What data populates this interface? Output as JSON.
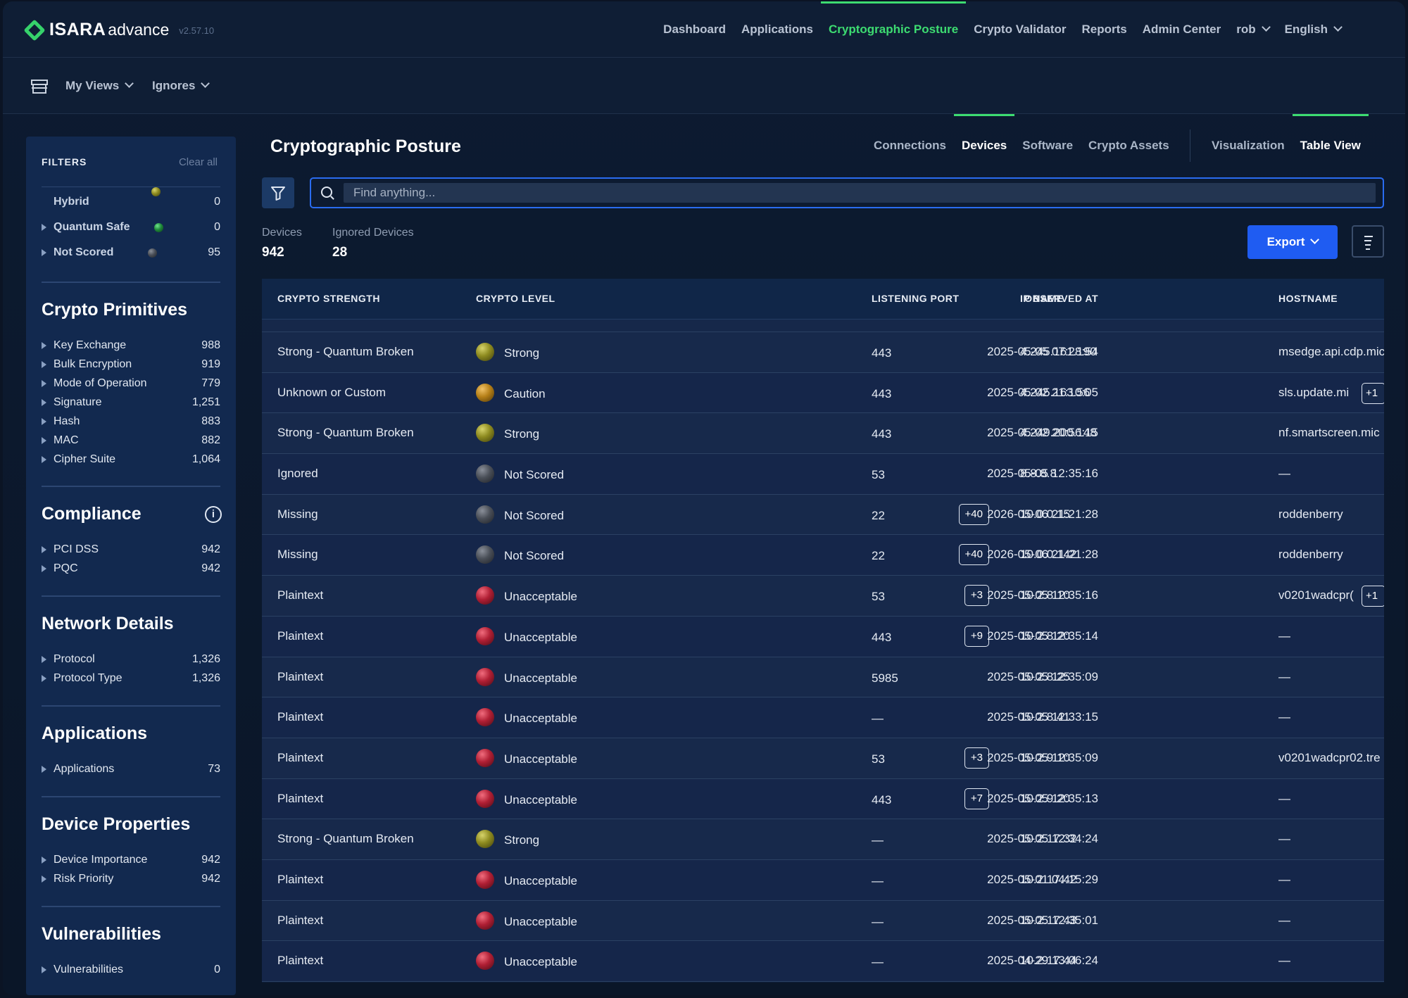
{
  "app": {
    "brand": "ISARA",
    "brand_sub": "advance",
    "version": "v2.57.10",
    "colors": {
      "accent": "#3ddc71",
      "primary": "#1f5cf2",
      "panel": "#12294f"
    }
  },
  "topnav": {
    "items": [
      "Dashboard",
      "Applications",
      "Cryptographic Posture",
      "Crypto Validator",
      "Reports",
      "Admin Center"
    ],
    "active": "Cryptographic Posture",
    "user": "rob",
    "language": "English"
  },
  "subbar": {
    "icon": "store-icon",
    "my_views": "My Views",
    "ignores": "Ignores"
  },
  "filters": {
    "title": "FILTERS",
    "clear_all": "Clear all",
    "score_rows": [
      {
        "label": "Hybrid",
        "count": "0",
        "color": "#8d8a1f"
      },
      {
        "label": "Quantum Safe",
        "count": "0",
        "color": "#1f8a3b"
      },
      {
        "label": "Not Scored",
        "count": "95",
        "color": "#4a4f58"
      }
    ],
    "sections": [
      {
        "title": "Crypto Primitives",
        "items": [
          {
            "label": "Key Exchange",
            "count": "988"
          },
          {
            "label": "Bulk Encryption",
            "count": "919"
          },
          {
            "label": "Mode of Operation",
            "count": "779"
          },
          {
            "label": "Signature",
            "count": "1,251"
          },
          {
            "label": "Hash",
            "count": "883"
          },
          {
            "label": "MAC",
            "count": "882"
          },
          {
            "label": "Cipher Suite",
            "count": "1,064"
          }
        ]
      },
      {
        "title": "Compliance",
        "items": [
          {
            "label": "PCI DSS",
            "count": "942"
          },
          {
            "label": "PQC",
            "count": "942"
          }
        ]
      },
      {
        "title": "Network Details",
        "items": [
          {
            "label": "Protocol",
            "count": "1,326"
          },
          {
            "label": "Protocol Type",
            "count": "1,326"
          }
        ]
      },
      {
        "title": "Applications",
        "items": [
          {
            "label": "Applications",
            "count": "73"
          }
        ]
      },
      {
        "title": "Device Properties",
        "items": [
          {
            "label": "Device Importance",
            "count": "942"
          },
          {
            "label": "Risk Priority",
            "count": "942"
          }
        ]
      },
      {
        "title": "Vulnerabilities",
        "items": [
          {
            "label": "Vulnerabilities",
            "count": "0"
          }
        ]
      }
    ]
  },
  "page": {
    "title": "Cryptographic Posture",
    "tabs": [
      "Connections",
      "Devices",
      "Software",
      "Crypto Assets"
    ],
    "active_tab": "Devices",
    "view_tabs": [
      "Visualization",
      "Table View"
    ],
    "active_view": "Table View",
    "search_placeholder": "Find anything...",
    "stats": [
      {
        "label": "Devices",
        "value": "942"
      },
      {
        "label": "Ignored Devices",
        "value": "28"
      }
    ],
    "export_label": "Export"
  },
  "table": {
    "columns": [
      "CRYPTO STRENGTH",
      "CRYPTO LEVEL",
      "OBSERVED AT",
      "LISTENING PORT",
      "IP NAME",
      "HOSTNAME"
    ],
    "rows": [
      {
        "strength": "Strong - Quantum Broken",
        "level": "Strong",
        "observed": "2025-05-05 07:28:54",
        "port": "443",
        "port_more": "",
        "ip": "4.245.161.190",
        "host": "msedge.api.cdp.mic",
        "host_more": ""
      },
      {
        "strength": "Unknown or Custom",
        "level": "Caution",
        "observed": "2025-05-02 21:10:05",
        "port": "443",
        "port_more": "",
        "ip": "4.245.163.56",
        "host": "sls.update.mi",
        "host_more": "+1"
      },
      {
        "strength": "Strong - Quantum Broken",
        "level": "Strong",
        "observed": "2025-05-02 20:56:15",
        "port": "443",
        "port_more": "",
        "ip": "4.249.200.148",
        "host": "nf.smartscreen.mic",
        "host_more": ""
      },
      {
        "strength": "Ignored",
        "level": "Not Scored",
        "observed": "2025-05-05 12:35:16",
        "port": "53",
        "port_more": "",
        "ip": "8.8.8.8",
        "host": "—",
        "host_more": ""
      },
      {
        "strength": "Missing",
        "level": "Not Scored",
        "observed": "2026-05-06 21:21:28",
        "port": "22",
        "port_more": "+40",
        "ip": "10.0.0.15",
        "host": "roddenberry",
        "host_more": ""
      },
      {
        "strength": "Missing",
        "level": "Not Scored",
        "observed": "2026-05-06 21:21:28",
        "port": "22",
        "port_more": "+40",
        "ip": "10.0.0.142",
        "host": "roddenberry",
        "host_more": ""
      },
      {
        "strength": "Plaintext",
        "level": "Unacceptable",
        "observed": "2025-05-05 12:35:16",
        "port": "53",
        "port_more": "+3",
        "ip": "10.2.8.10",
        "host": "v0201wadcpr(",
        "host_more": "+1"
      },
      {
        "strength": "Plaintext",
        "level": "Unacceptable",
        "observed": "2025-05-05 12:35:14",
        "port": "443",
        "port_more": "+9",
        "ip": "10.2.8.20",
        "host": "—",
        "host_more": ""
      },
      {
        "strength": "Plaintext",
        "level": "Unacceptable",
        "observed": "2025-05-05 12:35:09",
        "port": "5985",
        "port_more": "",
        "ip": "10.2.8.25",
        "host": "—",
        "host_more": ""
      },
      {
        "strength": "Plaintext",
        "level": "Unacceptable",
        "observed": "2025-05-05 12:33:15",
        "port": "—",
        "port_more": "",
        "ip": "10.2.8.41",
        "host": "—",
        "host_more": ""
      },
      {
        "strength": "Plaintext",
        "level": "Unacceptable",
        "observed": "2025-05-05 12:35:09",
        "port": "53",
        "port_more": "+3",
        "ip": "10.2.9.10",
        "host": "v0201wadcpr02.tre",
        "host_more": ""
      },
      {
        "strength": "Plaintext",
        "level": "Unacceptable",
        "observed": "2025-05-05 12:35:13",
        "port": "443",
        "port_more": "+7",
        "ip": "10.2.9.20",
        "host": "—",
        "host_more": ""
      },
      {
        "strength": "Strong - Quantum Broken",
        "level": "Strong",
        "observed": "2025-05-05 12:34:24",
        "port": "—",
        "port_more": "",
        "ip": "10.2.17.32",
        "host": "—",
        "host_more": ""
      },
      {
        "strength": "Plaintext",
        "level": "Unacceptable",
        "observed": "2025-05-01 04:15:29",
        "port": "—",
        "port_more": "",
        "ip": "10.2.17.42",
        "host": "—",
        "host_more": ""
      },
      {
        "strength": "Plaintext",
        "level": "Unacceptable",
        "observed": "2025-05-05 12:35:01",
        "port": "—",
        "port_more": "",
        "ip": "10.2.17.43",
        "host": "—",
        "host_more": ""
      },
      {
        "strength": "Plaintext",
        "level": "Unacceptable",
        "observed": "2025-04-29 13:06:24",
        "port": "—",
        "port_more": "",
        "ip": "10.2.17.44",
        "host": "—",
        "host_more": ""
      }
    ]
  }
}
